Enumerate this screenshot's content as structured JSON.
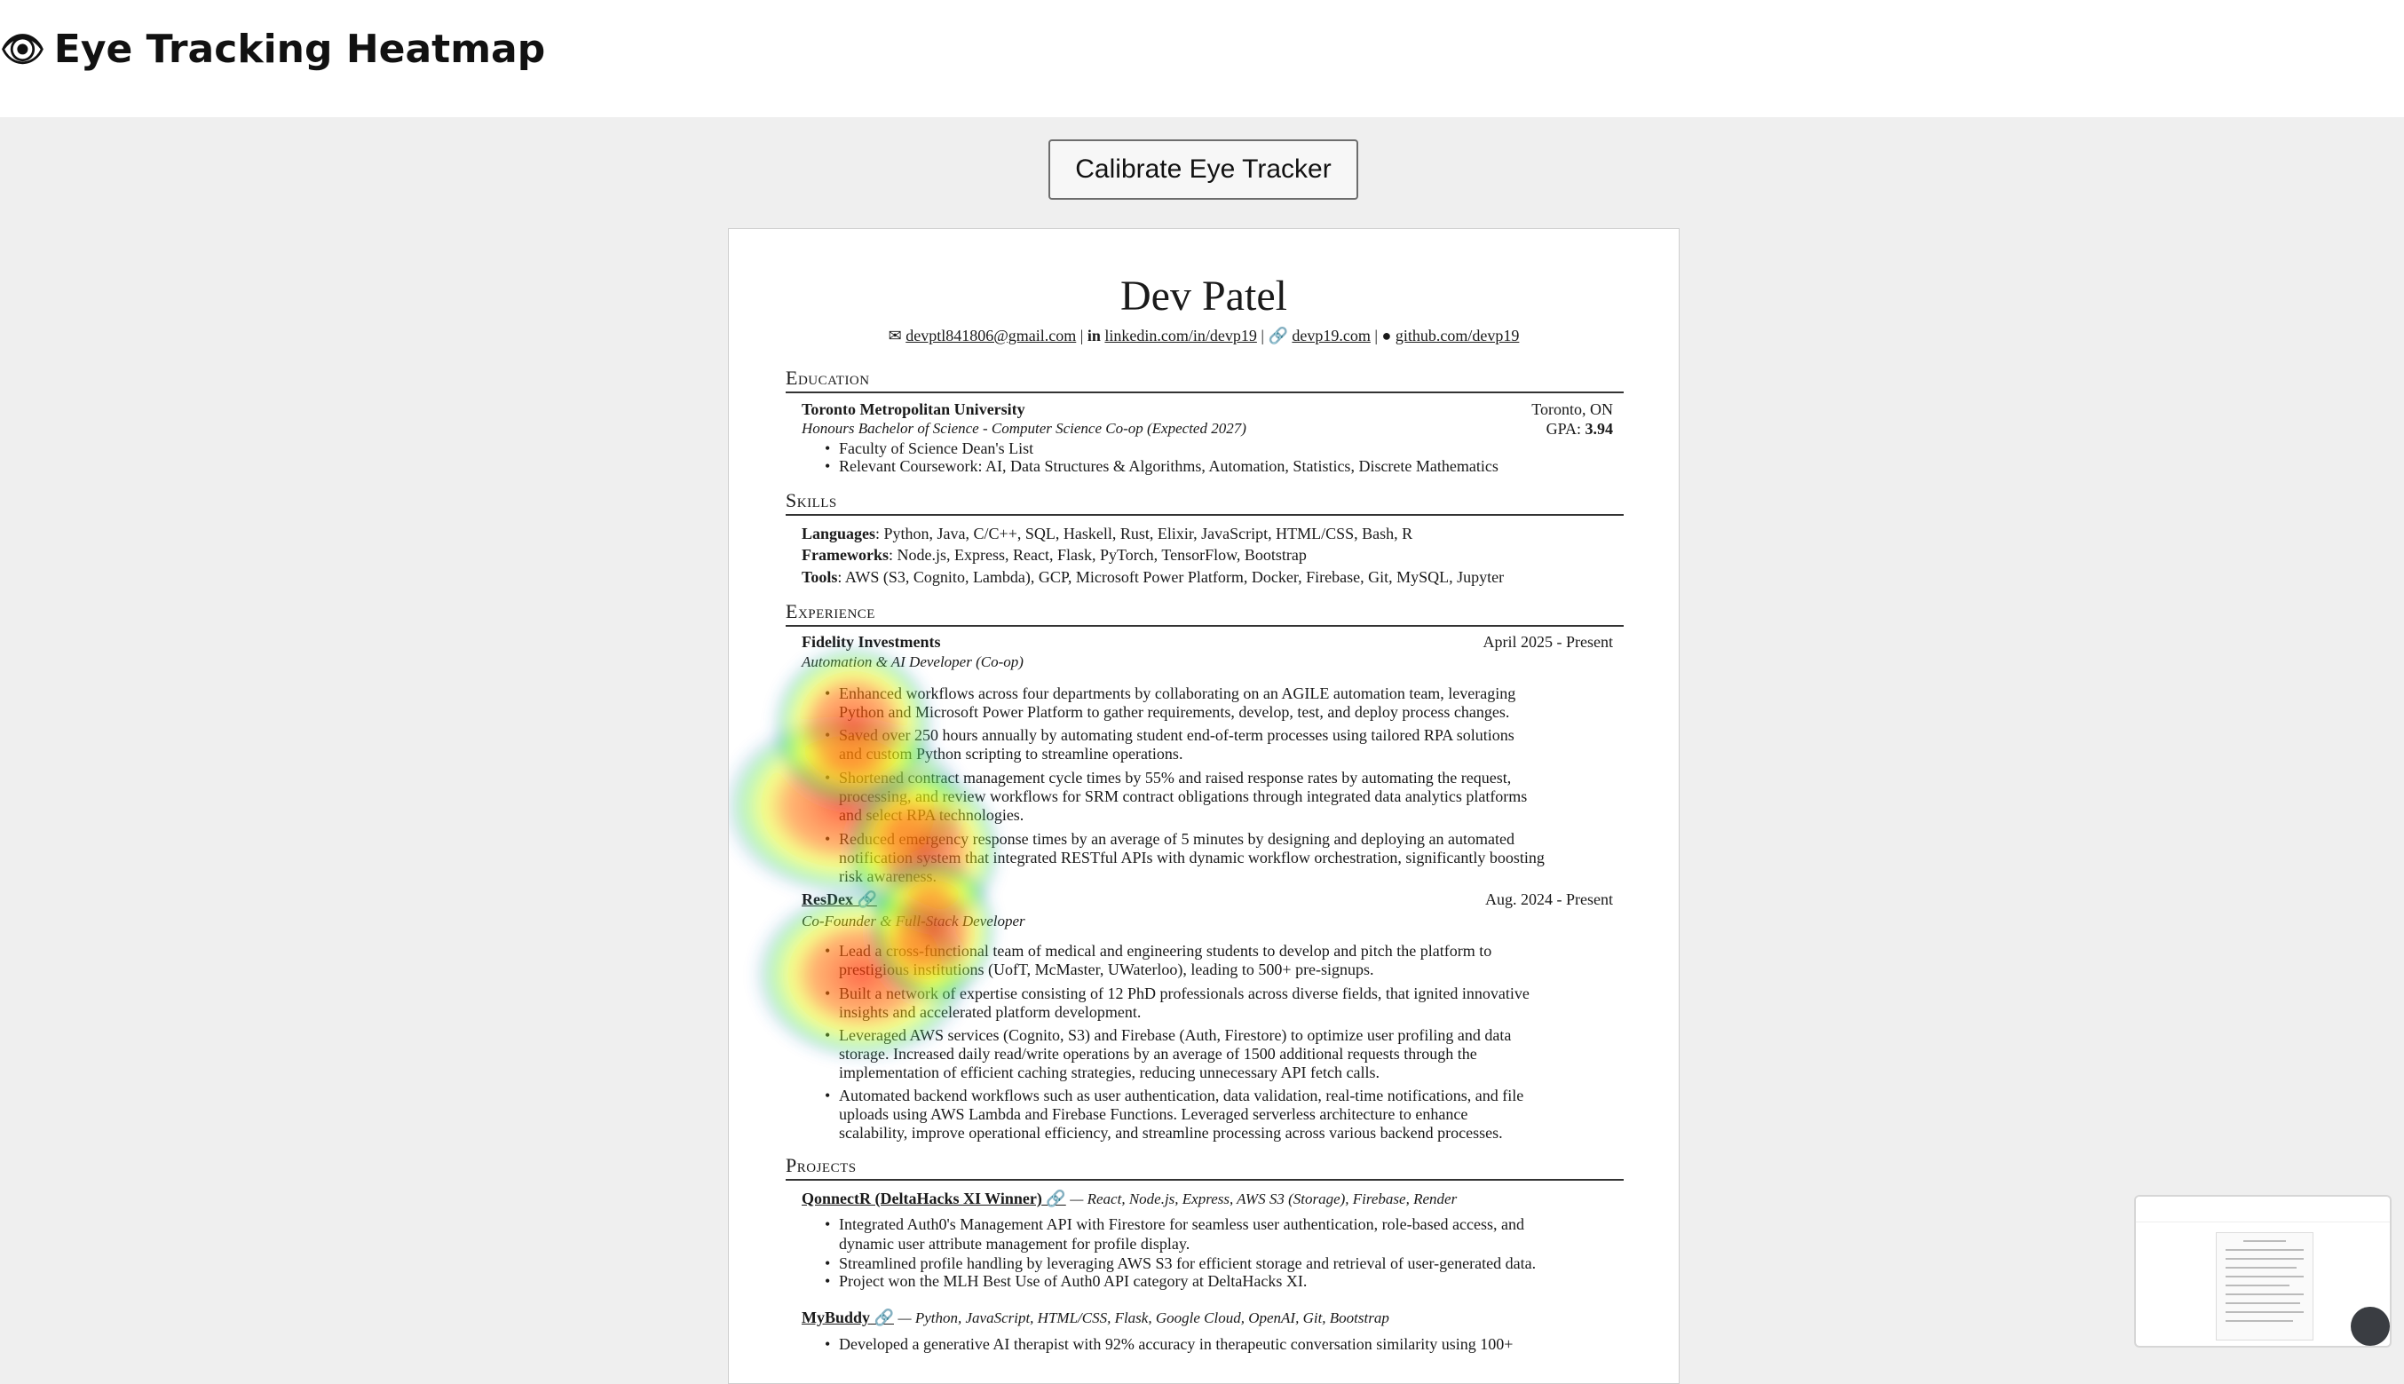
{
  "app": {
    "title": "Eye Tracking Heatmap",
    "icon": "eye-emoji"
  },
  "toolbar": {
    "calibrate_label": "Calibrate Eye Tracker"
  },
  "resume": {
    "name": "Dev Patel",
    "contact": {
      "email": "devptl841806@gmail.com",
      "linkedin": "linkedin.com/in/devp19",
      "website": "devp19.com",
      "github": "github.com/devp19"
    },
    "education": {
      "heading": "Education",
      "school": "Toronto Metropolitan University",
      "location": "Toronto, ON",
      "degree": "Honours Bachelor of Science - Computer Science Co-op (Expected 2027)",
      "gpa_label": "GPA:",
      "gpa_value": "3.94",
      "bullets": [
        "Faculty of Science Dean's List",
        "Relevant Coursework: AI, Data Structures & Algorithms, Automation, Statistics, Discrete Mathematics"
      ]
    },
    "skills": {
      "heading": "Skills",
      "languages_label": "Languages",
      "languages": ": Python, Java, C/C++, SQL, Haskell, Rust, Elixir, JavaScript, HTML/CSS, Bash, R",
      "frameworks_label": "Frameworks",
      "frameworks": ": Node.js, Express, React, Flask, PyTorch, TensorFlow, Bootstrap",
      "tools_label": "Tools",
      "tools": ": AWS (S3, Cognito, Lambda), GCP, Microsoft Power Platform, Docker, Firebase, Git, MySQL, Jupyter"
    },
    "experience": {
      "heading": "Experience",
      "job1": {
        "company": "Fidelity Investments",
        "dates": "April 2025 - Present",
        "role": "Automation & AI Developer (Co-op)",
        "bullets": [
          "Enhanced workflows across four departments by collaborating on an AGILE automation team, leveraging",
          "Python and Microsoft Power Platform to gather requirements, develop, test, and deploy process changes.",
          "Saved over 250 hours annually by automating student end-of-term processes using tailored RPA solutions",
          "and custom Python scripting to streamline operations.",
          "Shortened contract management cycle times by 55% and raised response rates by automating the request,",
          "processing, and review workflows for SRM contract obligations through integrated data analytics platforms",
          "and select RPA technologies.",
          "Reduced emergency response times by an average of 5 minutes by designing and deploying an automated",
          "notification system that integrated RESTful APIs with dynamic workflow orchestration, significantly boosting",
          "risk awareness."
        ]
      },
      "job2": {
        "company": "ResDex",
        "dates": "Aug. 2024 - Present",
        "role": "Co-Founder & Full-Stack Developer",
        "bullets": [
          "Lead a cross-functional team of medical and engineering students to develop and pitch the platform to",
          "prestigious institutions (UofT, McMaster, UWaterloo), leading to 500+ pre-signups.",
          "Built a network of expertise consisting of 12 PhD professionals across diverse fields, that ignited innovative",
          "insights and accelerated platform development.",
          "Leveraged AWS services (Cognito, S3) and Firebase (Auth, Firestore) to optimize user profiling and data",
          "storage. Increased daily read/write operations by an average of 1500 additional requests through the",
          "implementation of efficient caching strategies, reducing unnecessary API fetch calls.",
          "Automated backend workflows such as user authentication, data validation, real-time notifications, and file",
          "uploads using AWS Lambda and Firebase Functions. Leveraged serverless architecture to enhance",
          "scalability, improve operational efficiency, and streamline processing across various backend processes."
        ]
      }
    },
    "projects": {
      "heading": "Projects",
      "p1": {
        "name": "QonnectR (DeltaHacks XI Winner)",
        "stack": "— React, Node.js, Express, AWS S3 (Storage), Firebase, Render",
        "bullets": [
          "Integrated Auth0's Management API with Firestore for seamless user authentication, role-based access, and",
          "dynamic user attribute management for profile display.",
          "Streamlined profile handling by leveraging AWS S3 for efficient storage and retrieval of user-generated data.",
          "Project won the MLH Best Use of Auth0 API category at DeltaHacks XI."
        ]
      },
      "p2": {
        "name": "MyBuddy",
        "stack": "— Python, JavaScript, HTML/CSS, Flask, Google Cloud, OpenAI, Git, Bootstrap",
        "bullets": [
          "Developed a generative AI therapist with 92% accuracy in therapeutic conversation similarity using 100+"
        ]
      }
    }
  }
}
